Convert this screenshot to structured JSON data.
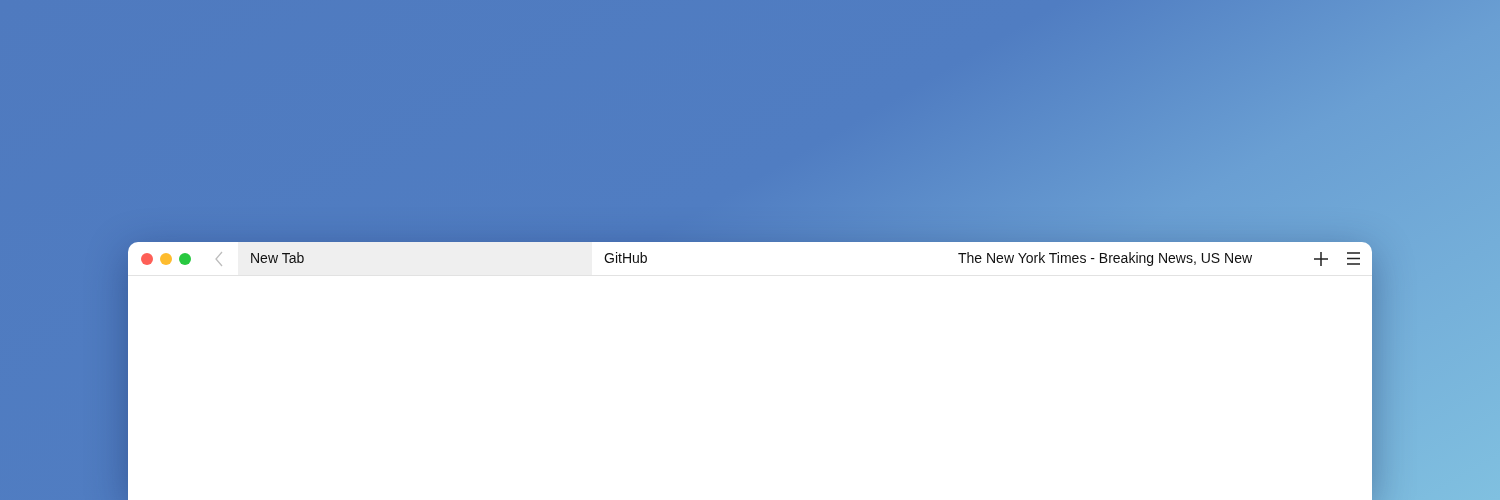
{
  "window": {
    "back_button": {
      "disabled": true
    },
    "tabs": [
      {
        "label": "New Tab",
        "selected": true
      },
      {
        "label": "GitHub",
        "selected": false
      },
      {
        "label": "The New York Times - Breaking News, US New",
        "selected": false
      }
    ]
  }
}
